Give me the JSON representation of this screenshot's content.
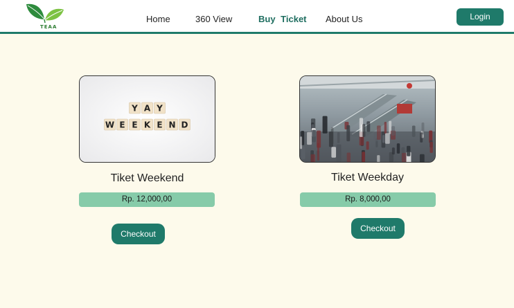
{
  "brand": {
    "logo_text": "TEAA",
    "logo_icon": "leaf-logo-icon"
  },
  "nav": {
    "items": [
      {
        "label": "Home"
      },
      {
        "label": "360 View"
      },
      {
        "label": "Buy Ticket",
        "active": true
      },
      {
        "label": "About Us"
      }
    ]
  },
  "header": {
    "login_label": "Login"
  },
  "tickets": [
    {
      "title": "Tiket Weekend",
      "price": "Rp. 12,000,00",
      "checkout_label": "Checkout",
      "image_tiles": [
        "Y",
        "A",
        "Y",
        "W",
        "E",
        "E",
        "K",
        "E",
        "N",
        "D"
      ]
    },
    {
      "title": "Tiket Weekday",
      "price": "Rp. 8,000,00",
      "checkout_label": "Checkout"
    }
  ],
  "colors": {
    "accent": "#1f7a6a",
    "price_bar": "#86cba9",
    "background": "#fdfaeb"
  }
}
